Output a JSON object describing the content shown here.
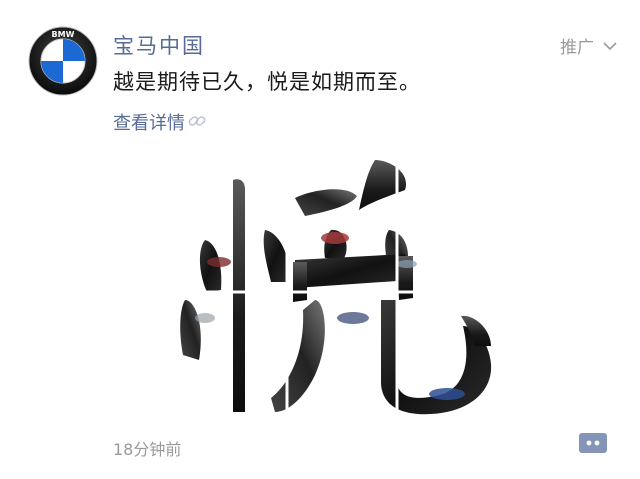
{
  "post": {
    "author": "宝马中国",
    "promo_label": "推广",
    "caption": "越是期待已久，悦是如期而至。",
    "details_link": "查看详情",
    "timestamp": "18分钟前"
  },
  "icons": {
    "avatar": "bmw-logo",
    "promo": "chevron-down-icon",
    "details": "link-icon",
    "comment": "comment-dots-icon"
  },
  "image": {
    "character": "悦",
    "description_tag": "bmw-cars-collage-character"
  },
  "logo_text": "BMW",
  "colors": {
    "link": "#576b95",
    "meta": "#9a9a9a",
    "text": "#1a1a1a",
    "comment_button": "#8595b8",
    "bmw_blue": "#1c69d4"
  }
}
